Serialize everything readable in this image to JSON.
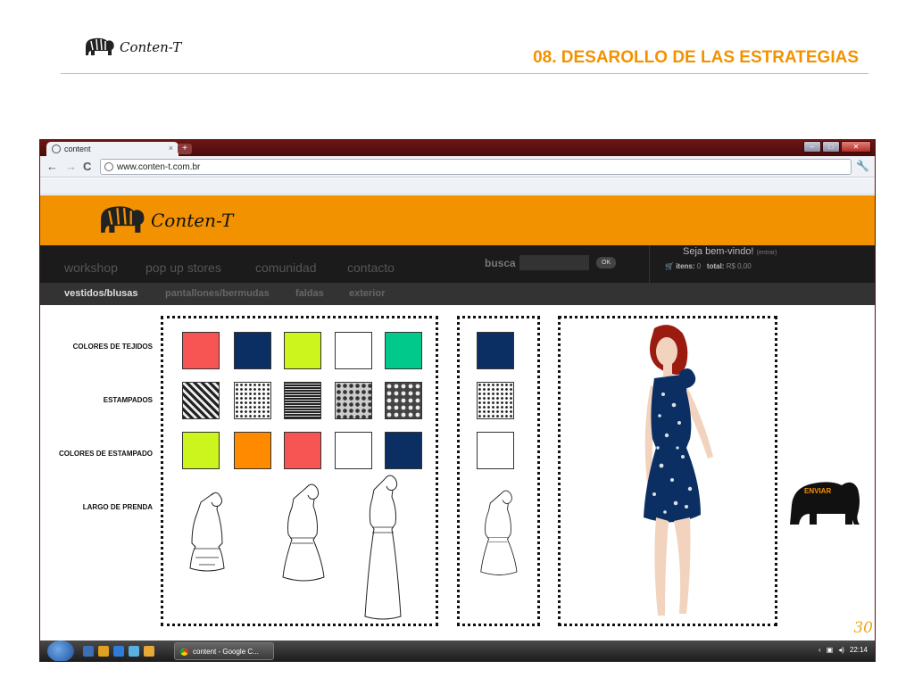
{
  "slide": {
    "logo_text": "Conten-T",
    "title": "08. DESAROLLO DE LAS ESTRATEGIAS",
    "page_number": "30"
  },
  "browser": {
    "tab_title": "content",
    "url": "www.conten-t.com.br",
    "taskbar_task": "content - Google C...",
    "clock": "22:14"
  },
  "site": {
    "logo_text": "Conten-T",
    "nav": [
      "workshop",
      "pop up stores",
      "comunidad",
      "contacto"
    ],
    "search_label": "busca",
    "search_button": "OK",
    "welcome": "Seja bem-vindo!",
    "welcome_link": "(entrar)",
    "cart_items_label": "itens:",
    "cart_items_value": "0",
    "cart_total_label": "total:",
    "cart_total_value": "R$ 0,00",
    "subnav": [
      "vestidos/blusas",
      "pantallones/bermudas",
      "faldas",
      "exterior"
    ]
  },
  "configurator": {
    "row_labels": [
      "COLORES DE TEJIDOS",
      "ESTAMPADOS",
      "COLORES DE ESTAMPADO",
      "LARGO DE PRENDA"
    ],
    "fabric_colors": [
      "#f75454",
      "#0b2f63",
      "#ccf51d",
      "#ffffff",
      "#00c98b"
    ],
    "print_colors": [
      "#ccf51d",
      "#ff8a00",
      "#f75454",
      "#ffffff",
      "#0b2f63"
    ],
    "pattern_names": [
      "geometric-print",
      "floral-print",
      "striped-print",
      "paisley-print",
      "large-floral-print"
    ],
    "selected_fabric_color": "#0b2f63",
    "selected_print_color": "#ffffff",
    "submit_label": "ENVIAR"
  },
  "colors": {
    "accent": "#f39200",
    "nav_dark": "#1b1b1b"
  }
}
